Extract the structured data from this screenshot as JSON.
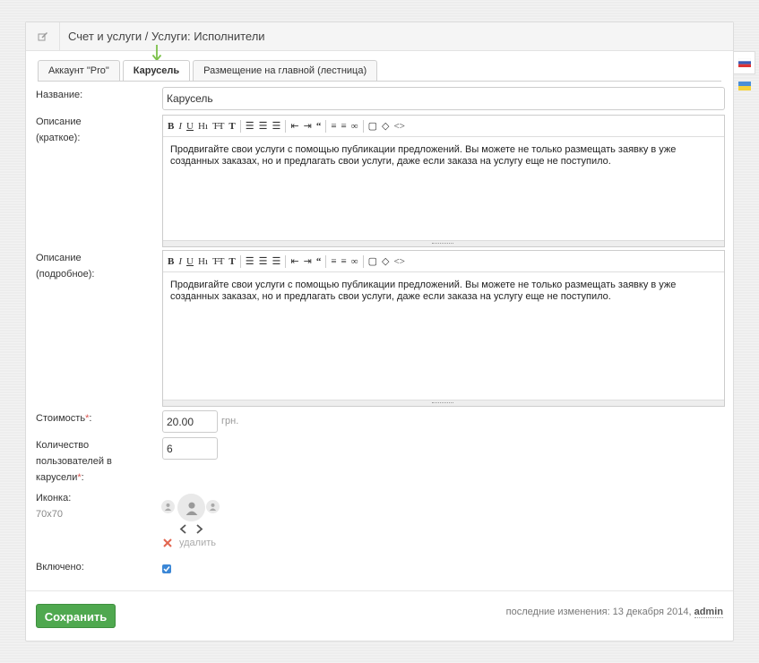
{
  "header": {
    "title": "Счет и услуги / Услуги: Исполнители"
  },
  "tabs": [
    {
      "label": "Аккаунт \"Pro\""
    },
    {
      "label": "Карусель"
    },
    {
      "label": "Размещение на главной (лестница)"
    }
  ],
  "fields": {
    "name": {
      "label": "Название:",
      "value": "Карусель"
    },
    "short_desc": {
      "label_line1": "Описание",
      "label_line2": "(краткое):",
      "text": "Продвигайте свои услуги с помощью публикации предложений. Вы можете не только размещать заявку в уже созданных заказах, но и предлагать свои услуги, даже если заказа на услугу еще не поступило."
    },
    "full_desc": {
      "label_line1": "Описание",
      "label_line2": "(подробное):",
      "text": "Продвигайте свои услуги с помощью публикации предложений. Вы можете не только размещать заявку в уже созданных заказах, но и предлагать свои услуги, даже если заказа на услугу еще не поступило."
    },
    "price": {
      "label": "Стоимость",
      "req": "*",
      "colon": ":",
      "value": "20.00",
      "unit": "грн."
    },
    "users_count": {
      "label_line1": "Количество",
      "label_line2": "пользователей в",
      "label_line3": "карусели",
      "req": "*",
      "colon": ":",
      "value": "6"
    },
    "icon": {
      "label": "Иконка:",
      "size": "70x70",
      "delete_label": "удалить"
    },
    "enabled": {
      "label": "Включено:",
      "checked": true
    }
  },
  "footer": {
    "save_label": "Сохранить",
    "meta_prefix": "последние изменения: 13 декабря 2014,",
    "meta_user": "admin"
  },
  "colors": {
    "accent": "#4fa84f",
    "required": "#d9534f",
    "arrow": "#7cc14a"
  }
}
